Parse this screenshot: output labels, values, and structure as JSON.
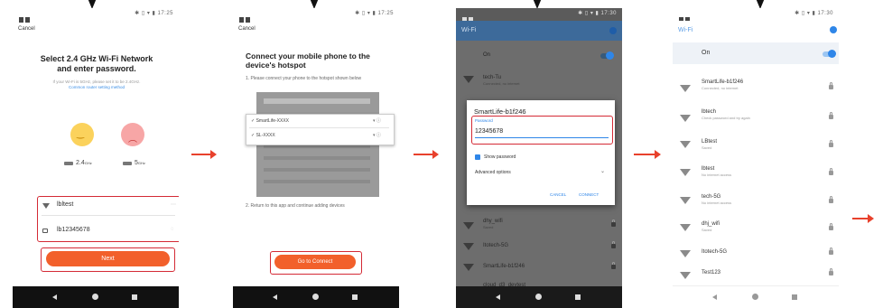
{
  "screen1": {
    "cancel": "Cancel",
    "title": "Select 2.4 GHz Wi-Fi Network and enter password.",
    "subtitle": "If your Wi-Fi is 5GHz, please set it to be 2.4GHz.",
    "router_link": "Common router setting method",
    "band_24": "2.4",
    "band_24_unit": "GHz",
    "band_5": "5",
    "band_5_unit": "GHz",
    "ssid": "lbltest",
    "password": "lb12345678",
    "next_label": "Next"
  },
  "screen2": {
    "cancel": "Cancel",
    "title": "Connect your mobile phone to the device's hotspot",
    "step1": "1. Please connect your phone to the hotspot shown below",
    "hotspot_1": "SmartLife-XXXX",
    "hotspot_2": "SL-XXXX",
    "step2": "2. Return to this app and continue adding devices",
    "go_connect_label": "Go to Connect"
  },
  "screen3": {
    "header": "Wi-Fi",
    "on_label": "On",
    "dialog_title": "SmartLife-b1f246",
    "password_label": "Password",
    "password_value": "12345678",
    "show_password": "Show password",
    "advanced_options": "Advanced options",
    "cancel_btn": "CANCEL",
    "connect_btn": "CONNECT",
    "bg_networks": [
      {
        "name": "tech-Tu",
        "sub": "Connected, no internet"
      },
      {
        "name": "dhy_wifi",
        "sub": "Saved"
      },
      {
        "name": "Itotech-5G",
        "sub": ""
      },
      {
        "name": "SmartLife-b1f246",
        "sub": ""
      },
      {
        "name": "cloud_d3_devtest",
        "sub": ""
      }
    ]
  },
  "screen4": {
    "header": "Wi-Fi",
    "on_label": "On",
    "networks": [
      {
        "name": "SmartLife-b1f246",
        "sub": "Connected, no internet"
      },
      {
        "name": "lbtech",
        "sub": "Check password and try again"
      },
      {
        "name": "LBtest",
        "sub": "Saved"
      },
      {
        "name": "lbtest",
        "sub": "No internet access"
      },
      {
        "name": "tech-5G",
        "sub": "No internet access"
      },
      {
        "name": "dhj_wifi",
        "sub": "Saved"
      },
      {
        "name": "Itotech-5G",
        "sub": ""
      },
      {
        "name": "Test123",
        "sub": ""
      }
    ]
  },
  "colors": {
    "accent_orange": "#f2602b",
    "highlight_red": "#d42a35",
    "android_blue": "#2f86e8",
    "arrow_red": "#e8412c"
  },
  "icons": [
    "wifi-icon",
    "lock-icon",
    "back-icon",
    "home-icon",
    "recent-apps-icon",
    "checkbox-icon",
    "chevron-down-icon",
    "happy-face-icon",
    "sad-face-icon",
    "router-icon"
  ]
}
